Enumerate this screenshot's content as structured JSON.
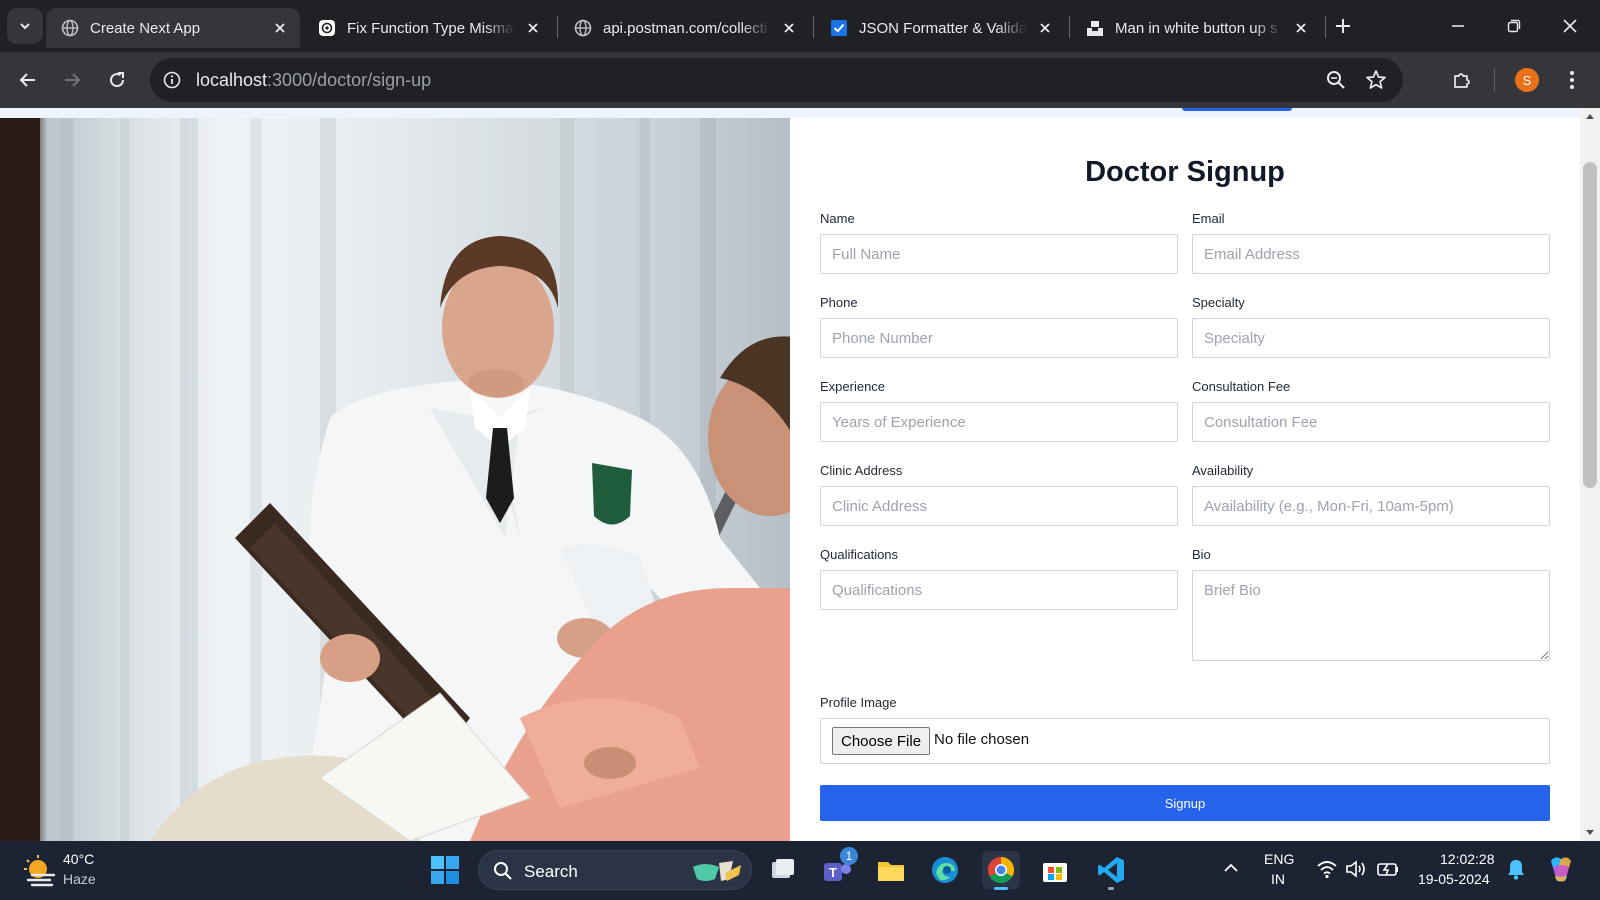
{
  "browser": {
    "tabs": [
      {
        "title": "Create Next App",
        "active": true,
        "icon": "globe-icon"
      },
      {
        "title": "Fix Function Type Mismat",
        "active": false,
        "icon": "chatgpt-icon"
      },
      {
        "title": "api.postman.com/collecti",
        "active": false,
        "icon": "globe-icon"
      },
      {
        "title": "JSON Formatter & Valida",
        "active": false,
        "icon": "checkbox-icon"
      },
      {
        "title": "Man in white button up s",
        "active": false,
        "icon": "unsplash-icon"
      }
    ],
    "url_host": "localhost",
    "url_path": ":3000/doctor/sign-up",
    "profile_initial": "S"
  },
  "form": {
    "title": "Doctor Signup",
    "fields": {
      "name": {
        "label": "Name",
        "placeholder": "Full Name"
      },
      "email": {
        "label": "Email",
        "placeholder": "Email Address"
      },
      "phone": {
        "label": "Phone",
        "placeholder": "Phone Number"
      },
      "specialty": {
        "label": "Specialty",
        "placeholder": "Specialty"
      },
      "experience": {
        "label": "Experience",
        "placeholder": "Years of Experience"
      },
      "fee": {
        "label": "Consultation Fee",
        "placeholder": "Consultation Fee"
      },
      "clinic": {
        "label": "Clinic Address",
        "placeholder": "Clinic Address"
      },
      "availability": {
        "label": "Availability",
        "placeholder": "Availability (e.g., Mon-Fri, 10am-5pm)"
      },
      "qualifications": {
        "label": "Qualifications",
        "placeholder": "Qualifications"
      },
      "bio": {
        "label": "Bio",
        "placeholder": "Brief Bio"
      }
    },
    "profile_image": {
      "label": "Profile Image",
      "button": "Choose File",
      "status": "No file chosen"
    },
    "submit": "Signup",
    "accent": "#2563eb"
  },
  "taskbar": {
    "weather_temp": "40°C",
    "weather_desc": "Haze",
    "search_label": "Search",
    "teams_badge": "1",
    "lang_top": "ENG",
    "lang_bottom": "IN",
    "time": "12:02:28",
    "date": "19-05-2024"
  }
}
